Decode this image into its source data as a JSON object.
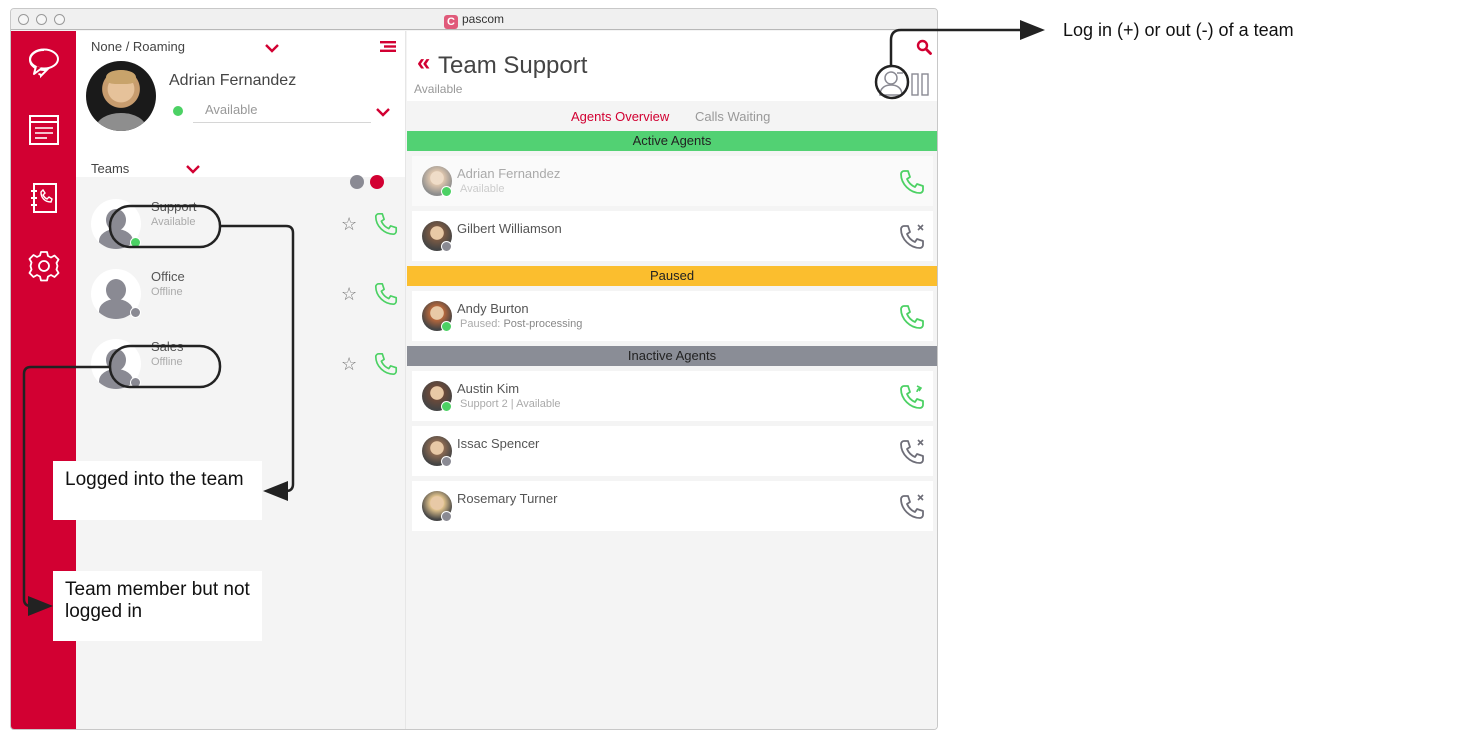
{
  "window": {
    "title": "pascom",
    "logo_glyph": "C"
  },
  "nav_rail": {
    "items": [
      {
        "name": "chat",
        "icon": "chat-bubble-icon"
      },
      {
        "name": "journal",
        "icon": "journal-icon"
      },
      {
        "name": "phonebook",
        "icon": "phonebook-icon"
      },
      {
        "name": "settings",
        "icon": "gear-icon"
      }
    ]
  },
  "user_panel": {
    "device": "None / Roaming",
    "user_name": "Adrian Fernandez",
    "presence": "Available",
    "presence_color": "#4cd164",
    "teams_label": "Teams"
  },
  "teams": [
    {
      "name": "Support",
      "status": "Available",
      "status_color": "#4cd164"
    },
    {
      "name": "Office",
      "status": "Offline",
      "status_color": "#8a8a93"
    },
    {
      "name": "Sales",
      "status": "Offline",
      "status_color": "#8a8a93"
    }
  ],
  "team_detail": {
    "back_glyph": "«",
    "title": "Team Support",
    "subtitle": "Available",
    "tabs": [
      {
        "label": "Agents Overview",
        "active": true
      },
      {
        "label": "Calls Waiting",
        "active": false
      }
    ],
    "sections": [
      {
        "label": "Active Agents",
        "color": "#52d173",
        "agents": [
          {
            "name": "Adrian Fernandez",
            "sub_label": "",
            "sub": "Available",
            "status_color": "#4cd164",
            "action": "call",
            "dim": true
          },
          {
            "name": "Gilbert Williamson",
            "sub_label": "",
            "sub": "",
            "status_color": "#8a8a93",
            "action": "unavailable",
            "dim": false
          }
        ]
      },
      {
        "label": "Paused",
        "color": "#fbbe2e",
        "agents": [
          {
            "name": "Andy Burton",
            "sub_label": "Paused:",
            "sub": "Post-processing",
            "status_color": "#4cd164",
            "action": "call",
            "dim": false
          }
        ]
      },
      {
        "label": "Inactive Agents",
        "color": "#8a8d96",
        "agents": [
          {
            "name": "Austin Kim",
            "sub_label": "",
            "sub": "Support 2 |  Available",
            "status_color": "#4cd164",
            "action": "callback",
            "dim": false
          },
          {
            "name": "Issac Spencer",
            "sub_label": "",
            "sub": "",
            "status_color": "#8a8a93",
            "action": "unavailable",
            "dim": false
          },
          {
            "name": "Rosemary Turner",
            "sub_label": "",
            "sub": "",
            "status_color": "#8a8a93",
            "action": "unavailable",
            "dim": false
          }
        ]
      }
    ]
  },
  "annotations": {
    "login_toggle": "Log in (+) or out (-) of a team",
    "logged_in": "Logged into the team",
    "not_logged_in": "Team member but not logged in"
  },
  "colors": {
    "brand": "#d20032",
    "available": "#4cd164",
    "offline": "#8a8a93",
    "paused": "#fbbe2e"
  }
}
